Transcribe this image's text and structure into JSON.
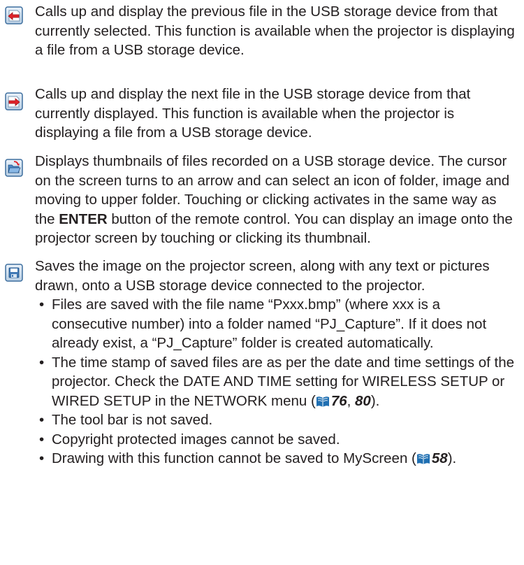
{
  "entries": [
    {
      "icon": "previous-file-icon",
      "description": "Calls up and display the previous file in the USB storage device from that currently selected. This function is available when the projector is displaying a file from a USB storage device."
    },
    {
      "icon": "next-file-icon",
      "description": "Calls up and display the next file in the USB storage device from that currently displayed. This function is available when the projector is displaying a file from a USB storage device."
    },
    {
      "icon": "open-folder-thumbnails-icon",
      "description_before": "Displays thumbnails of files recorded on a USB storage device. The cursor on the screen turns to an arrow and can select an icon of folder, image and moving to upper folder. Touching or clicking activates in the same way as the ",
      "description_bold": "ENTER",
      "description_after": " button of the remote control. You can display an image onto the projector screen by touching or clicking its thumbnail."
    },
    {
      "icon": "save-icon",
      "description": "Saves the image on the projector screen, along with any text or pictures drawn, onto a USB storage device connected to the projector.",
      "bullets": [
        {
          "text": "Files are saved with the file name “Pxxx.bmp” (where xxx is a consecutive number) into a folder named “PJ_Capture”. If it does not already exist, a “PJ_Capture” folder is created automatically."
        },
        {
          "text_before": "The time stamp of saved files are as per the date and time settings of the projector. Check the DATE AND TIME setting for WIRELESS SETUP or WIRED SETUP in the NETWORK menu (",
          "ref1": "76",
          "ref_sep": ", ",
          "ref2": "80",
          "text_after": ")."
        },
        {
          "text": "The tool bar is not saved."
        },
        {
          "text": "Copyright protected images cannot be saved."
        },
        {
          "text_before": "Drawing with this function cannot be saved to MyScreen (",
          "ref1": "58",
          "text_after": ")."
        }
      ]
    }
  ],
  "bullet_char": "•"
}
